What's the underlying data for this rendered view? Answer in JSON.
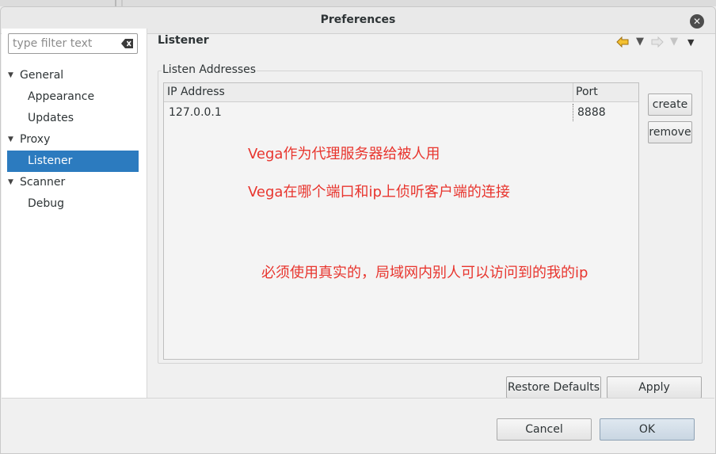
{
  "window": {
    "title": "Preferences"
  },
  "filter": {
    "placeholder": "type filter text",
    "value": ""
  },
  "tree": {
    "items": [
      {
        "label": "General",
        "level": 0,
        "expanded": true
      },
      {
        "label": "Appearance",
        "level": 1
      },
      {
        "label": "Updates",
        "level": 1
      },
      {
        "label": "Proxy",
        "level": 0,
        "expanded": true
      },
      {
        "label": "Listener",
        "level": 1,
        "selected": true
      },
      {
        "label": "Scanner",
        "level": 0,
        "expanded": true
      },
      {
        "label": "Debug",
        "level": 1
      }
    ]
  },
  "page": {
    "title": "Listener",
    "group_label": "Listen Addresses",
    "table": {
      "columns": [
        "IP Address",
        "Port"
      ],
      "rows": [
        {
          "ip": "127.0.0.1",
          "port": "8888"
        }
      ]
    },
    "annotations": [
      "Vega作为代理服务器给被人用",
      "Vega在哪个端口和ip上侦听客户端的连接",
      "必须使用真实的，局域网内别人可以访问到的我的ip"
    ],
    "buttons": {
      "create": "create",
      "remove": "remove",
      "restore_defaults": "Restore Defaults",
      "apply": "Apply"
    }
  },
  "dialog_buttons": {
    "cancel": "Cancel",
    "ok": "OK"
  },
  "colors": {
    "selection": "#2c7bbf",
    "annotation": "#e8352e",
    "nav_back": "#e0a020"
  },
  "icons": {
    "back": "back-arrow-icon",
    "forward": "forward-arrow-icon",
    "menu": "view-menu-icon",
    "clear": "clear-filter-icon",
    "close": "close-icon"
  }
}
